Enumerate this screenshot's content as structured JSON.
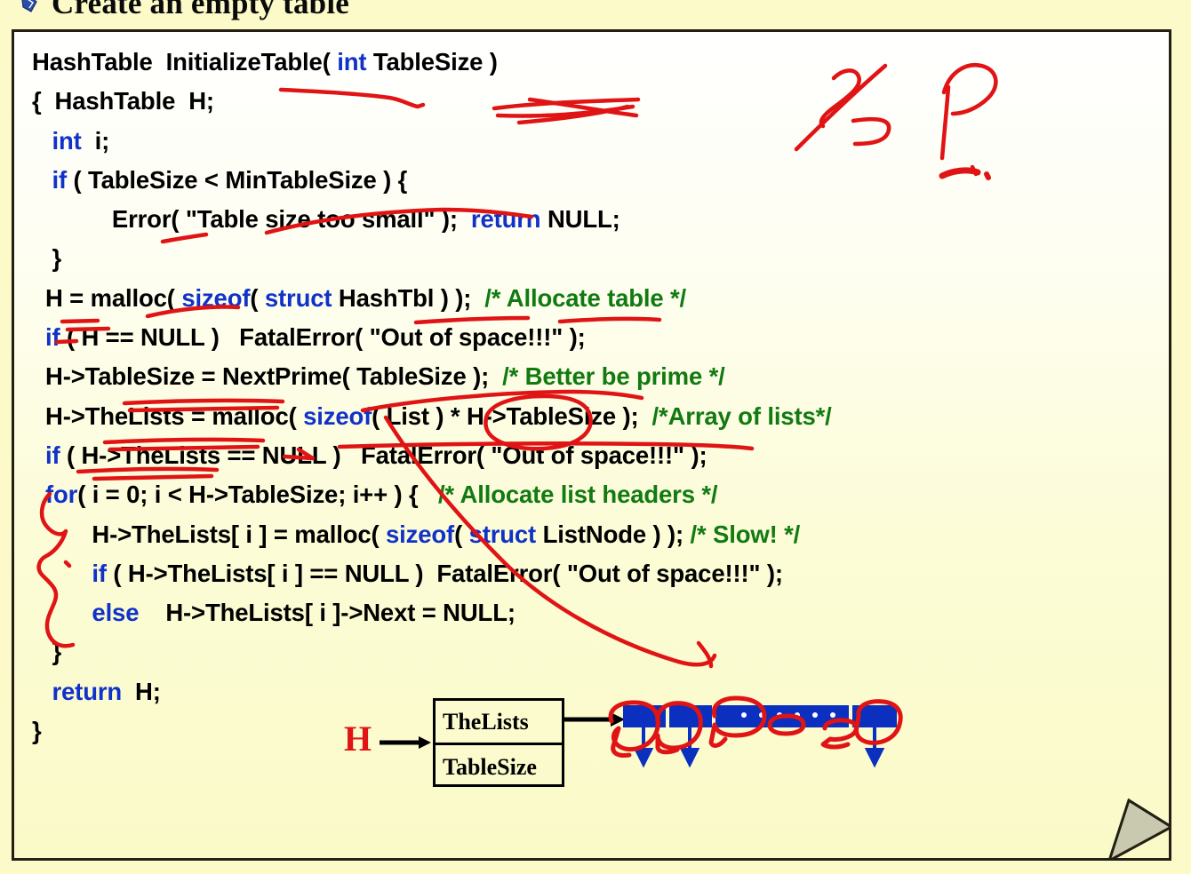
{
  "slide": {
    "title": "Create an empty table",
    "bullet_icon": "blue-diamond-bullet-icon",
    "page_bg": "#FBFAC8",
    "panel_border": "#231F14"
  },
  "colors": {
    "keyword_blue": "#1032C8",
    "comment_green": "#117A11",
    "ink_red": "#E01414",
    "array_blue": "#0B2FBE",
    "text_black": "#000000"
  },
  "code": {
    "language": "C",
    "lines": [
      [
        {
          "t": "HashTable  InitializeTable( ",
          "c": "plain"
        },
        {
          "t": "int",
          "c": "kw"
        },
        {
          "t": " TableSize )",
          "c": "plain"
        }
      ],
      [
        {
          "t": "{  HashTable  H;",
          "c": "plain"
        }
      ],
      [
        {
          "t": "   ",
          "c": "plain"
        },
        {
          "t": "int",
          "c": "kw"
        },
        {
          "t": "  i;",
          "c": "plain"
        }
      ],
      [
        {
          "t": "   ",
          "c": "plain"
        },
        {
          "t": "if",
          "c": "kw"
        },
        {
          "t": " ( TableSize < MinTableSize ) {",
          "c": "plain"
        }
      ],
      [
        {
          "t": "            Error( \"Table size too small\" );  ",
          "c": "plain"
        },
        {
          "t": "return",
          "c": "kw"
        },
        {
          "t": " NULL;",
          "c": "plain"
        }
      ],
      [
        {
          "t": "   }",
          "c": "plain"
        }
      ],
      [
        {
          "t": "  H = malloc( ",
          "c": "plain"
        },
        {
          "t": "sizeof",
          "c": "kw"
        },
        {
          "t": "( ",
          "c": "plain"
        },
        {
          "t": "struct",
          "c": "kw"
        },
        {
          "t": " HashTbl ) );  ",
          "c": "plain"
        },
        {
          "t": "/* Allocate table */",
          "c": "cm"
        }
      ],
      [
        {
          "t": "  ",
          "c": "plain"
        },
        {
          "t": "if",
          "c": "kw"
        },
        {
          "t": " ( H == NULL )   FatalError( \"Out of space!!!\" );",
          "c": "plain"
        }
      ],
      [
        {
          "t": "  H->TableSize = NextPrime( TableSize );  ",
          "c": "plain"
        },
        {
          "t": "/* Better be prime */",
          "c": "cm"
        }
      ],
      [
        {
          "t": "  H->TheLists = malloc( ",
          "c": "plain"
        },
        {
          "t": "sizeof",
          "c": "kw"
        },
        {
          "t": "( List ) * H->TableSize );  ",
          "c": "plain"
        },
        {
          "t": "/*Array of lists*/",
          "c": "cm"
        }
      ],
      [
        {
          "t": "  ",
          "c": "plain"
        },
        {
          "t": "if",
          "c": "kw"
        },
        {
          "t": " ( H->TheLists == NULL )   FatalError( \"Out of space!!!\" );",
          "c": "plain"
        }
      ],
      [
        {
          "t": "  ",
          "c": "plain"
        },
        {
          "t": "for",
          "c": "kw"
        },
        {
          "t": "( i = 0; i < H->TableSize; i++ ) {   ",
          "c": "plain"
        },
        {
          "t": "/* Allocate list headers */",
          "c": "cm"
        }
      ],
      [
        {
          "t": "         H->TheLists[ i ] = malloc( ",
          "c": "plain"
        },
        {
          "t": "sizeof",
          "c": "kw"
        },
        {
          "t": "( ",
          "c": "plain"
        },
        {
          "t": "struct",
          "c": "kw"
        },
        {
          "t": " ListNode ) ); ",
          "c": "plain"
        },
        {
          "t": "/* Slow! */",
          "c": "cm"
        }
      ],
      [
        {
          "t": "         ",
          "c": "plain"
        },
        {
          "t": "if",
          "c": "kw"
        },
        {
          "t": " ( H->TheLists[ i ] == NULL )  FatalError( \"Out of space!!!\" );",
          "c": "plain"
        }
      ],
      [
        {
          "t": "         ",
          "c": "plain"
        },
        {
          "t": "else",
          "c": "kw"
        },
        {
          "t": "    H->TheLists[ i ]->Next = NULL;",
          "c": "plain"
        }
      ],
      [
        {
          "t": "   }",
          "c": "plain"
        }
      ],
      [
        {
          "t": "   ",
          "c": "plain"
        },
        {
          "t": "return",
          "c": "kw"
        },
        {
          "t": "  H;",
          "c": "plain"
        }
      ],
      [
        {
          "t": "}",
          "c": "plain"
        }
      ]
    ]
  },
  "diagram": {
    "pointer_label": "H",
    "struct_fields": [
      "TheLists",
      "TableSize"
    ],
    "array_cell_count": 4,
    "ellipsis_dot_count": 6,
    "down_arrow_count": 3,
    "handdrawn_blob_count": 6
  },
  "annotations": {
    "ink_color": "#E01414",
    "marks": [
      "underline-InitializeTable",
      "scribble-TableSize-param",
      "strike-through-MinTableSize-line",
      "strike-through-Error-line",
      "underline-H-assign",
      "underline-struct",
      "underline-HashTbl",
      "underline-TableSize-member",
      "underline-NextPrime-arg",
      "underline-TheLists-member",
      "circle-List",
      "underline-H-TableSize-multiplier",
      "underline-TheLists-null-check",
      "brace-for-loop-body",
      "long-diagonal-slash-through-loop",
      "fraction-slash-glyph-top-right",
      "question-mark-glyph-top-right",
      "blob-arrow-top-right",
      "blobs-over-list-headers"
    ]
  }
}
